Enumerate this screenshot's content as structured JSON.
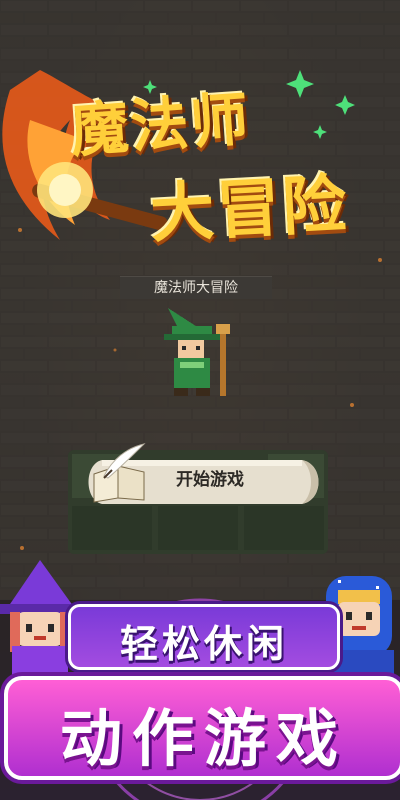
{
  "game": {
    "logo_line1": "魔法师",
    "logo_line2": "大冒险",
    "title_plate": "魔法师大冒险",
    "start_button": "开始游戏"
  },
  "promo": {
    "tagline_top": "轻松休闲",
    "tagline_bottom": "动作游戏"
  },
  "icons": {
    "quill": "quill-pen-icon",
    "book": "open-book-icon"
  },
  "colors": {
    "logo_gold": "#ffcf3a",
    "accent_purple": "#8a3ee0",
    "accent_pink": "#ff5fd5"
  }
}
